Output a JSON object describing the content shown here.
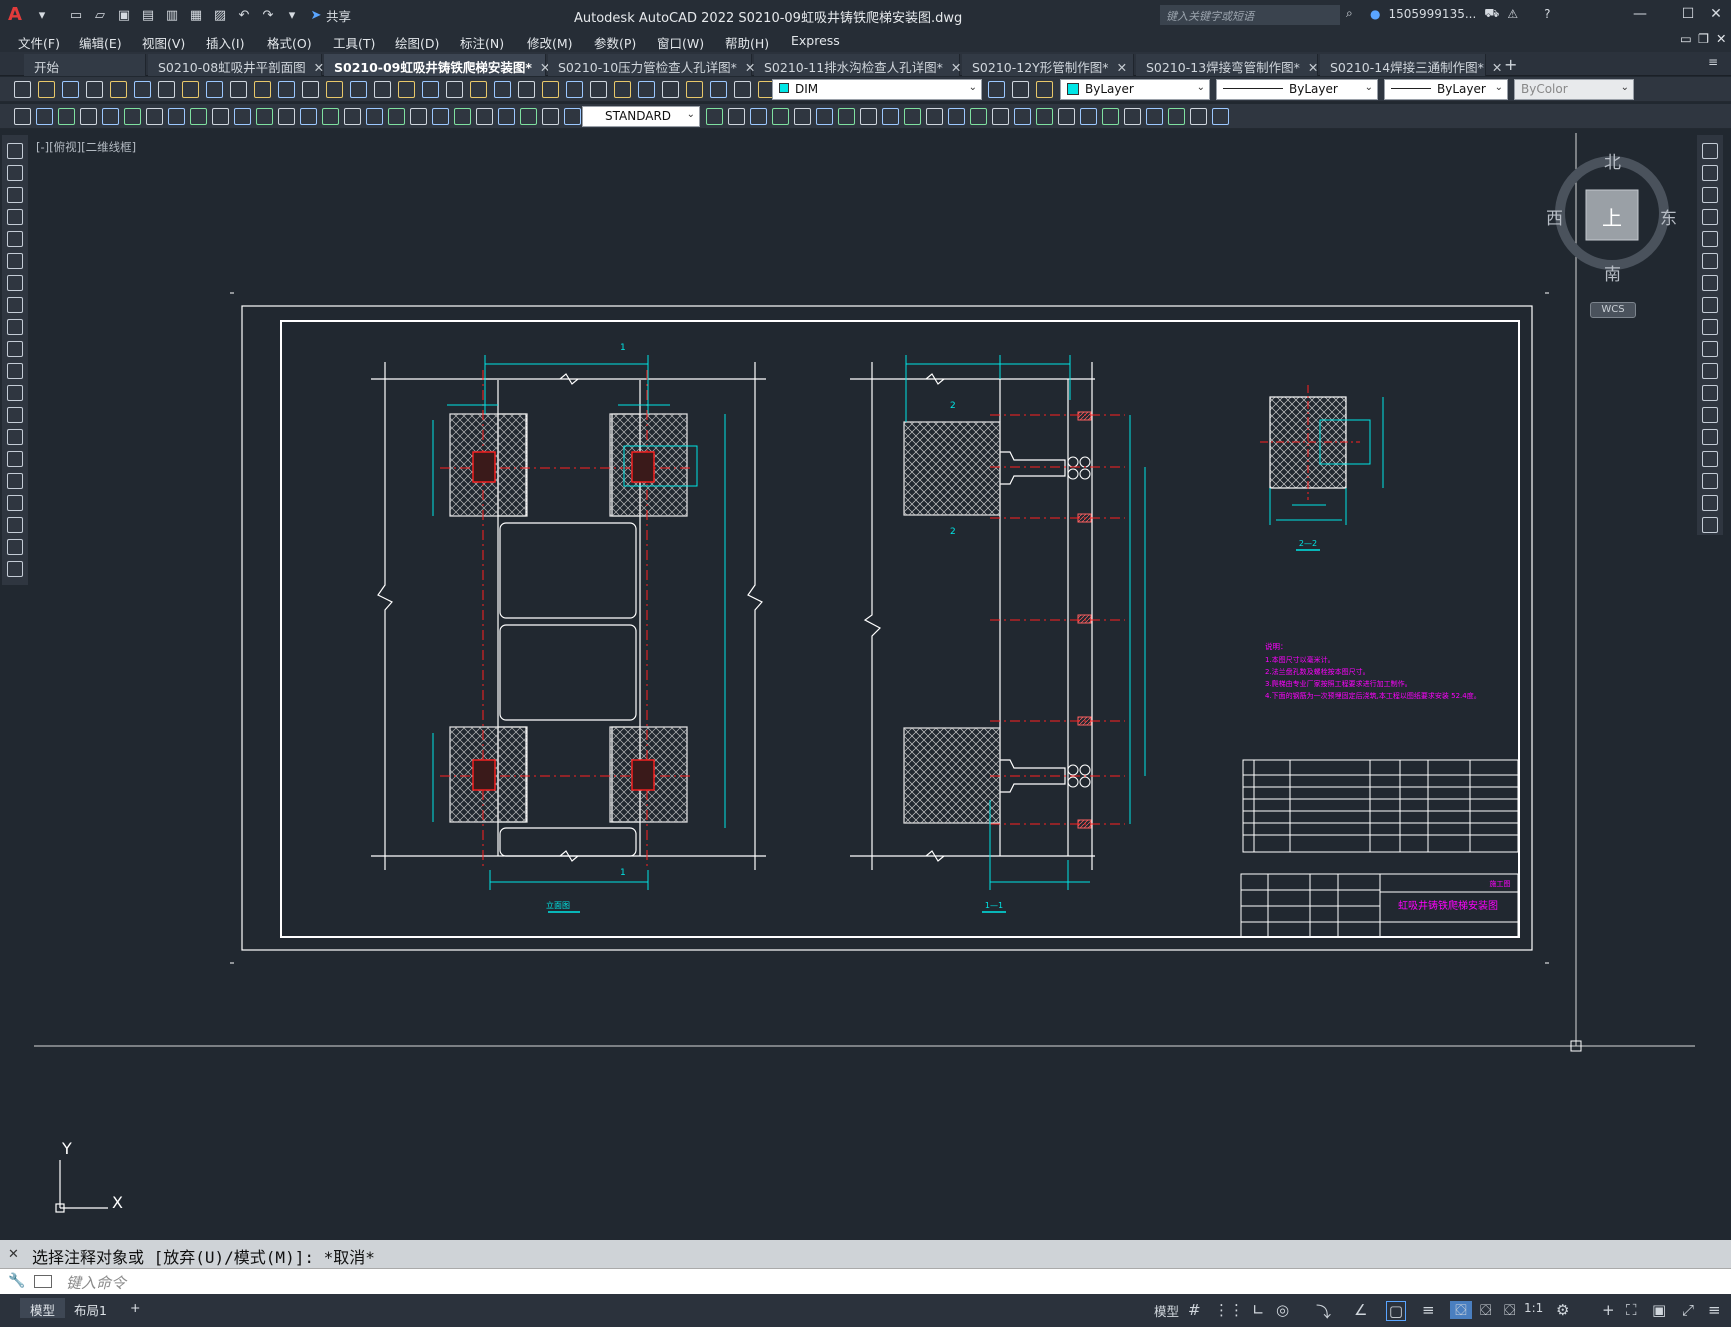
{
  "app": {
    "logo": "A",
    "title": "Autodesk AutoCAD 2022    S0210-09虹吸井铸铁爬梯安装图.dwg",
    "search_placeholder": "键入关键字或短语",
    "user": "1505999135...",
    "share_label": "共享",
    "icons": [
      "new-icon",
      "open-icon",
      "save-icon",
      "saveas-icon",
      "print-icon",
      "undo-icon",
      "redo-icon",
      "share-icon",
      "cart-icon",
      "help-icon",
      "minimize-icon",
      "maximize-icon",
      "close-icon"
    ]
  },
  "menu": [
    "文件(F)",
    "编辑(E)",
    "视图(V)",
    "插入(I)",
    "格式(O)",
    "工具(T)",
    "绘图(D)",
    "标注(N)",
    "修改(M)",
    "参数(P)",
    "窗口(W)",
    "帮助(H)",
    "Express"
  ],
  "tabs": [
    {
      "label": "开始"
    },
    {
      "label": "S0210-08虹吸井平剖面图"
    },
    {
      "label": "S0210-09虹吸井铸铁爬梯安装图*"
    },
    {
      "label": "S0210-10压力管检查人孔详图*"
    },
    {
      "label": "S0210-11排水沟检查人孔详图*"
    },
    {
      "label": "S0210-12Y形管制作图*"
    },
    {
      "label": "S0210-13焊接弯管制作图*"
    },
    {
      "label": "S0210-14焊接三通制作图*"
    }
  ],
  "active_tab": 2,
  "properties": {
    "layer": "DIM",
    "color": "ByLayer",
    "linetype": "ByLayer",
    "lineweight": "ByLayer",
    "plotstyle": "ByColor",
    "text_style": "STANDARD"
  },
  "viewport": {
    "label": "[-][俯视][二维线框]",
    "viewcube": {
      "north": "北",
      "south": "南",
      "east": "东",
      "west": "西",
      "face": "上",
      "wcs": "WCS"
    },
    "ucs": {
      "x": "X",
      "y": "Y"
    }
  },
  "drawing": {
    "view_titles": [
      "立面图",
      "1—1",
      "2—2"
    ],
    "section_marks": [
      "1",
      "2"
    ],
    "notes_title": "说明：",
    "notes": [
      "1.本图尺寸以毫米计。",
      "2.法兰盘孔数及螺栓按本图尺寸。",
      "3.爬梯由专业厂家按照工程要求进行加工制作。",
      "4.下面的钢筋为一次预埋固定后浇筑,本工程以图纸要求安装 52.4度。"
    ],
    "title_block": "虹吸井铸铁爬梯安装图",
    "design_stage": "施工图"
  },
  "command": {
    "history": "选择注释对象或 [放弃(U)/模式(M)]: *取消*",
    "placeholder": "键入命令"
  },
  "layouts": [
    "模型",
    "布局1",
    "+"
  ],
  "status": {
    "model_label": "模型",
    "scale": "1:1"
  },
  "colors": {
    "background": "#212830",
    "paper_border": "#ffffff",
    "dim": "#00e5e5",
    "center": "#ff2020",
    "notes": "#ff00ff",
    "hatch": "#d0d0d0"
  }
}
